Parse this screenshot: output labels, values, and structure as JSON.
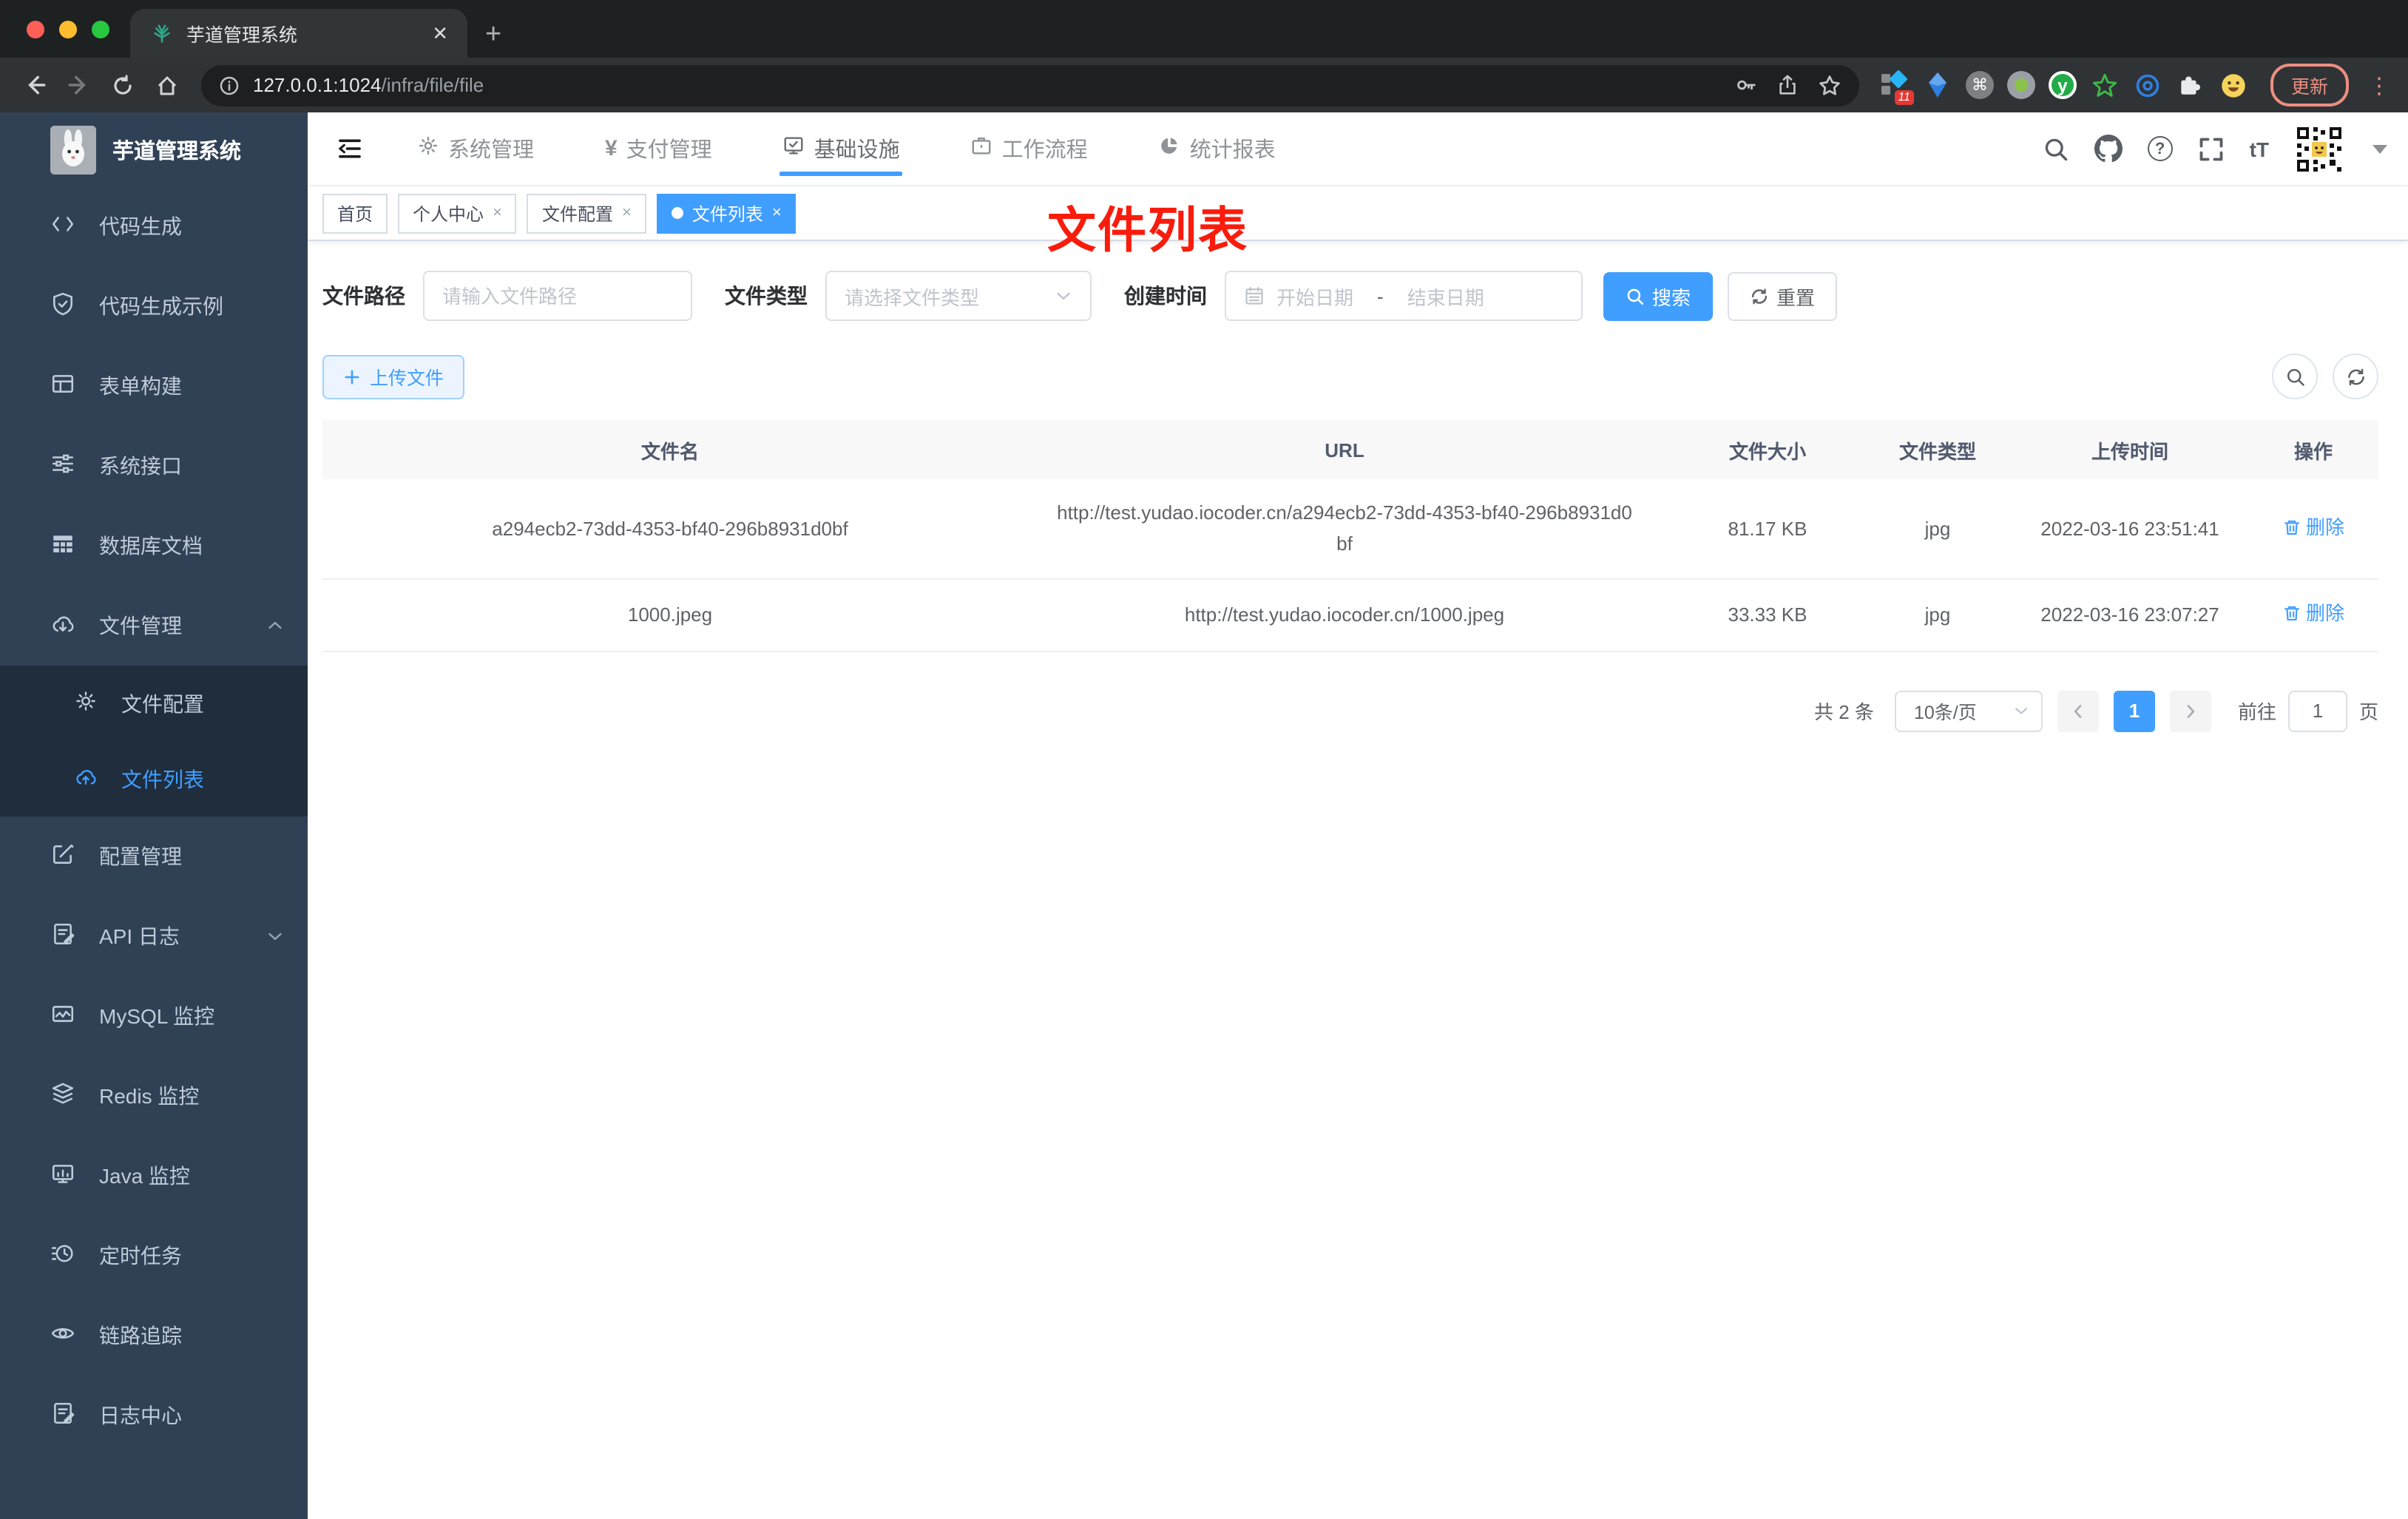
{
  "browser": {
    "tab_title": "芋道管理系统",
    "tab_close_glyph": "✕",
    "new_tab_glyph": "+",
    "url_host": "127.0.0.1:1024",
    "url_path": "/infra/file/file",
    "extension_badge": "11",
    "cmd_glyph": "⌘",
    "y_glyph": "y",
    "update_label": "更新",
    "kebab_glyph": "⋮"
  },
  "app": {
    "logo_title": "芋道管理系统",
    "glyphs": {
      "yen": "¥",
      "font_size": "tT",
      "question": "?",
      "tag_close": "×"
    },
    "top_nav": {
      "items": [
        {
          "label": "系统管理",
          "icon": "gear-icon"
        },
        {
          "label": "支付管理",
          "icon": "yen-icon"
        },
        {
          "label": "基础设施",
          "icon": "monitor-check-icon",
          "active": true
        },
        {
          "label": "工作流程",
          "icon": "briefcase-icon"
        },
        {
          "label": "统计报表",
          "icon": "pie-chart-icon"
        }
      ]
    },
    "sidebar": {
      "items": [
        {
          "label": "代码生成",
          "icon": "code-icon"
        },
        {
          "label": "代码生成示例",
          "icon": "shield-check-icon"
        },
        {
          "label": "表单构建",
          "icon": "form-table-icon"
        },
        {
          "label": "系统接口",
          "icon": "sliders-icon"
        },
        {
          "label": "数据库文档",
          "icon": "db-grid-icon"
        },
        {
          "label": "文件管理",
          "icon": "cloud-download-icon",
          "expanded": true,
          "children": [
            {
              "label": "文件配置",
              "icon": "gear-icon"
            },
            {
              "label": "文件列表",
              "icon": "cloud-upload-icon",
              "active": true
            }
          ]
        },
        {
          "label": "配置管理",
          "icon": "edit-square-icon"
        },
        {
          "label": "API 日志",
          "icon": "doc-edit-icon",
          "collapsed": true
        },
        {
          "label": "MySQL 监控",
          "icon": "chart-monitor-icon"
        },
        {
          "label": "Redis 监控",
          "icon": "layers-icon"
        },
        {
          "label": "Java 监控",
          "icon": "java-monitor-icon"
        },
        {
          "label": "定时任务",
          "icon": "timer-icon"
        },
        {
          "label": "链路追踪",
          "icon": "eye-icon"
        },
        {
          "label": "日志中心",
          "icon": "doc-edit-icon"
        }
      ]
    },
    "tags": {
      "items": [
        {
          "label": "首页",
          "closable": false,
          "active": false
        },
        {
          "label": "个人中心",
          "closable": true,
          "active": false
        },
        {
          "label": "文件配置",
          "closable": true,
          "active": false
        },
        {
          "label": "文件列表",
          "closable": true,
          "active": true
        }
      ]
    },
    "annotation": "文件列表",
    "filter": {
      "path_label": "文件路径",
      "path_placeholder": "请输入文件路径",
      "type_label": "文件类型",
      "type_placeholder": "请选择文件类型",
      "date_label": "创建时间",
      "date_start_placeholder": "开始日期",
      "date_separator": "-",
      "date_end_placeholder": "结束日期",
      "search_label": "搜索",
      "reset_label": "重置"
    },
    "toolbar": {
      "upload_label": "上传文件"
    },
    "table": {
      "headers": [
        "文件名",
        "URL",
        "文件大小",
        "文件类型",
        "上传时间",
        "操作"
      ],
      "rows": [
        {
          "name": "a294ecb2-73dd-4353-bf40-296b8931d0bf",
          "url": "http://test.yudao.iocoder.cn/a294ecb2-73dd-4353-bf40-296b8931d0bf",
          "size": "81.17 KB",
          "type": "jpg",
          "time": "2022-03-16 23:51:41",
          "action": "删除"
        },
        {
          "name": "1000.jpeg",
          "url": "http://test.yudao.iocoder.cn/1000.jpeg",
          "size": "33.33 KB",
          "type": "jpg",
          "time": "2022-03-16 23:07:27",
          "action": "删除"
        }
      ]
    },
    "pagination": {
      "total": "共 2 条",
      "page_size": "10条/页",
      "current_page": "1",
      "goto_label": "前往",
      "goto_value": "1",
      "goto_unit": "页"
    },
    "accent_color": "#409eff",
    "annotation_color": "#f91c0c",
    "sidebar_color": "#304156"
  }
}
